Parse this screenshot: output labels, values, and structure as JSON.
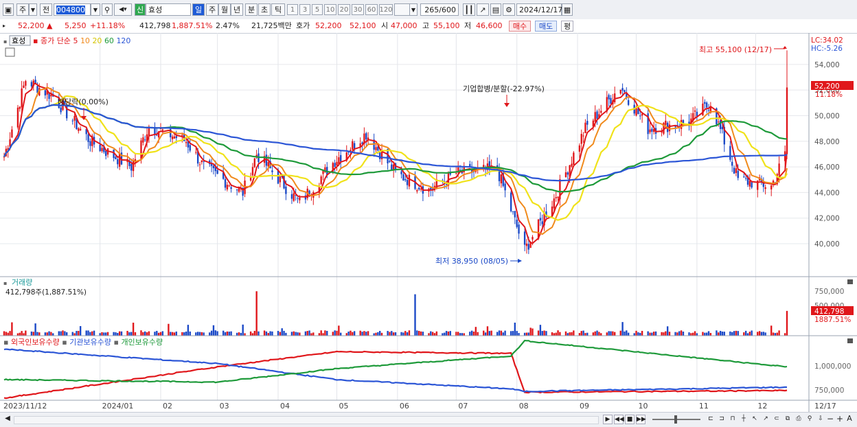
{
  "toolbar": {
    "market": "주",
    "period_type": "전",
    "stock_code": "004800",
    "badge": "신",
    "stock_name": "효성",
    "periods": [
      "일",
      "주",
      "월",
      "년",
      "분",
      "초",
      "틱"
    ],
    "counts": [
      "1",
      "3",
      "5",
      "10",
      "20",
      "30",
      "60",
      "120"
    ],
    "bar_count": "265",
    "bar_max": "/600",
    "date": "2024/12/17"
  },
  "quote": {
    "price": "52,200",
    "change": "5,250",
    "change_pct": "+11.18%",
    "volume": "412,798",
    "vol_ratio": "1,887.51%",
    "turnover": "2.47%",
    "amount": "21,725백만",
    "ask_label": "호가",
    "ask": "52,200",
    "bid": "52,100",
    "open_label": "시",
    "open": "47,000",
    "high_label": "고",
    "high": "55,100",
    "low_label": "저",
    "low": "46,600",
    "buy_label": "매수",
    "sell_label": "매도",
    "eval_label": "평"
  },
  "price_panel": {
    "stock_tag": "효성",
    "indicator_prefix": "종가 단순",
    "ma_periods": [
      "5",
      "10",
      "20",
      "60",
      "120"
    ],
    "ma_colors": [
      "#e0171b",
      "#f08a1c",
      "#f0e21a",
      "#1e9a3a",
      "#2b55d6"
    ],
    "lc_label": "LC:34.02",
    "hc_label": "HC:-5.26",
    "yticks": [
      "54,000",
      "52,000",
      "50,000",
      "48,000",
      "46,000",
      "44,000",
      "42,000",
      "40,000"
    ],
    "current_tag": "52,200",
    "current_pct": "11.18%",
    "ann_high": "최고 55,100 (12/17)",
    "ann_low": "최저 38,950 (08/05)",
    "ann_merge": "기업합병/분할(-22.97%)",
    "ann_exdiv": "배당락(0.00%)"
  },
  "volume_panel": {
    "title": "거래량",
    "sub": "412,798주(1,887.51%)",
    "yticks": [
      "750,000",
      "500,000"
    ],
    "current_tag": "412,798",
    "current_pct": "1887.51%"
  },
  "hold_panel": {
    "legend": [
      "외국인보유수량",
      "기관보유수량",
      "개인보유수량"
    ],
    "legend_colors": [
      "#e0171b",
      "#2b55d6",
      "#1e9a3a"
    ],
    "yticks": [
      "1,000,000",
      "750,000"
    ]
  },
  "xaxis": {
    "labels": [
      "2023/11/12",
      "2024/01",
      "02",
      "03",
      "04",
      "05",
      "06",
      "07",
      "08",
      "09",
      "10",
      "11",
      "12"
    ],
    "right_label": "12/17"
  },
  "bottom": {
    "zoom_minus": "−",
    "zoom_plus": "+",
    "font_label": "A"
  },
  "chart_data": {
    "type": "candlestick",
    "title": "효성 (004800) 일봉",
    "anchors": [
      [
        "2023-11-13",
        46800,
        "start"
      ],
      [
        "2023-11-24",
        52800,
        "uptrend"
      ],
      [
        "2023-12-08",
        51500,
        "decline"
      ],
      [
        "2023-12-27",
        48000,
        "ex-dividend 배당락"
      ],
      [
        "2024-01-17",
        46000,
        "low"
      ],
      [
        "2024-01-26",
        49200,
        "rebound"
      ],
      [
        "2024-02-14",
        48000,
        ""
      ],
      [
        "2024-02-23",
        46000,
        ""
      ],
      [
        "2024-03-14",
        44000,
        ""
      ],
      [
        "2024-03-21",
        47000,
        "spike"
      ],
      [
        "2024-04-12",
        43200,
        "low"
      ],
      [
        "2024-04-30",
        46500,
        ""
      ],
      [
        "2024-05-16",
        48600,
        "peak"
      ],
      [
        "2024-05-31",
        45500,
        ""
      ],
      [
        "2024-06-17",
        44200,
        ""
      ],
      [
        "2024-07-01",
        45500,
        ""
      ],
      [
        "2024-07-22",
        45800,
        "기업합병/분할(-22.97%)"
      ],
      [
        "2024-08-05",
        39500,
        "최저 38,950 (08/05)"
      ],
      [
        "2024-08-20",
        43500,
        ""
      ],
      [
        "2024-09-05",
        49000,
        ""
      ],
      [
        "2024-09-23",
        52300,
        "peak"
      ],
      [
        "2024-10-07",
        49000,
        ""
      ],
      [
        "2024-10-28",
        49500,
        ""
      ],
      [
        "2024-11-08",
        51000,
        ""
      ],
      [
        "2024-11-22",
        45000,
        ""
      ],
      [
        "2024-12-09",
        44500,
        ""
      ],
      [
        "2024-12-16",
        46950,
        ""
      ],
      [
        "2024-12-17",
        52200,
        "최고 55,100 (12/17)"
      ]
    ],
    "last_candle": {
      "open": 47000,
      "high": 55100,
      "low": 46600,
      "close": 52200,
      "volume": 412798
    },
    "ylim": [
      38500,
      55600
    ],
    "volume_peaks": [
      [
        "2024-03-21",
        740000
      ],
      [
        "2024-06-10",
        690000
      ],
      [
        "2024-08-13",
        720000
      ],
      [
        "2024-12-17",
        412798
      ]
    ],
    "holdings": {
      "foreign": [
        [
          "2023-11-13",
          650000
        ],
        [
          "2024-03-01",
          1020000
        ],
        [
          "2024-05-01",
          1200000
        ],
        [
          "2024-07-29",
          1180000
        ],
        [
          "2024-08-05",
          720000
        ],
        [
          "2024-12-17",
          740000
        ]
      ],
      "institution": [
        [
          "2023-11-13",
          1230000
        ],
        [
          "2024-03-01",
          1060000
        ],
        [
          "2024-05-01",
          870000
        ],
        [
          "2024-07-29",
          760000
        ],
        [
          "2024-08-05",
          730000
        ],
        [
          "2024-12-17",
          780000
        ]
      ],
      "individual": [
        [
          "2023-11-13",
          870000
        ],
        [
          "2024-03-01",
          840000
        ],
        [
          "2024-05-01",
          1000000
        ],
        [
          "2024-07-29",
          1150000
        ],
        [
          "2024-08-05",
          1330000
        ],
        [
          "2024-12-17",
          1020000
        ]
      ]
    }
  }
}
